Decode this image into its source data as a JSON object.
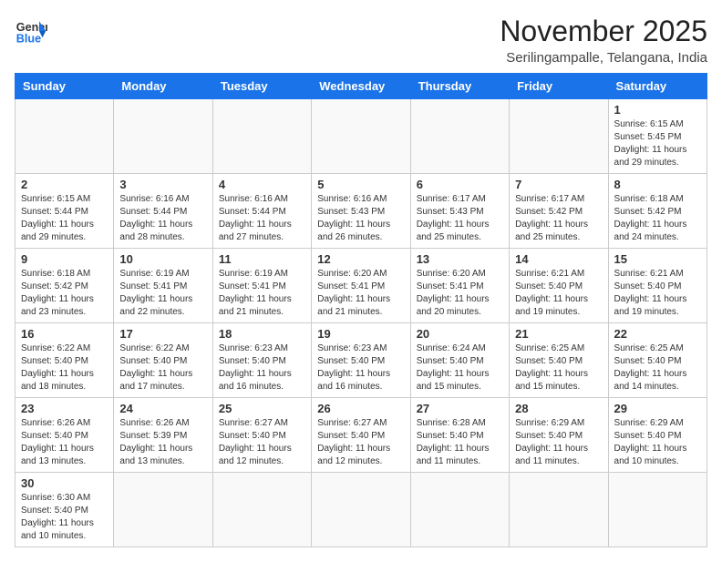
{
  "logo": {
    "text_general": "General",
    "text_blue": "Blue"
  },
  "header": {
    "month": "November 2025",
    "location": "Serilingampalle, Telangana, India"
  },
  "weekdays": [
    "Sunday",
    "Monday",
    "Tuesday",
    "Wednesday",
    "Thursday",
    "Friday",
    "Saturday"
  ],
  "weeks": [
    [
      {
        "day": "",
        "content": ""
      },
      {
        "day": "",
        "content": ""
      },
      {
        "day": "",
        "content": ""
      },
      {
        "day": "",
        "content": ""
      },
      {
        "day": "",
        "content": ""
      },
      {
        "day": "",
        "content": ""
      },
      {
        "day": "1",
        "content": "Sunrise: 6:15 AM\nSunset: 5:45 PM\nDaylight: 11 hours and 29 minutes."
      }
    ],
    [
      {
        "day": "2",
        "content": "Sunrise: 6:15 AM\nSunset: 5:44 PM\nDaylight: 11 hours and 29 minutes."
      },
      {
        "day": "3",
        "content": "Sunrise: 6:16 AM\nSunset: 5:44 PM\nDaylight: 11 hours and 28 minutes."
      },
      {
        "day": "4",
        "content": "Sunrise: 6:16 AM\nSunset: 5:44 PM\nDaylight: 11 hours and 27 minutes."
      },
      {
        "day": "5",
        "content": "Sunrise: 6:16 AM\nSunset: 5:43 PM\nDaylight: 11 hours and 26 minutes."
      },
      {
        "day": "6",
        "content": "Sunrise: 6:17 AM\nSunset: 5:43 PM\nDaylight: 11 hours and 25 minutes."
      },
      {
        "day": "7",
        "content": "Sunrise: 6:17 AM\nSunset: 5:42 PM\nDaylight: 11 hours and 25 minutes."
      },
      {
        "day": "8",
        "content": "Sunrise: 6:18 AM\nSunset: 5:42 PM\nDaylight: 11 hours and 24 minutes."
      }
    ],
    [
      {
        "day": "9",
        "content": "Sunrise: 6:18 AM\nSunset: 5:42 PM\nDaylight: 11 hours and 23 minutes."
      },
      {
        "day": "10",
        "content": "Sunrise: 6:19 AM\nSunset: 5:41 PM\nDaylight: 11 hours and 22 minutes."
      },
      {
        "day": "11",
        "content": "Sunrise: 6:19 AM\nSunset: 5:41 PM\nDaylight: 11 hours and 21 minutes."
      },
      {
        "day": "12",
        "content": "Sunrise: 6:20 AM\nSunset: 5:41 PM\nDaylight: 11 hours and 21 minutes."
      },
      {
        "day": "13",
        "content": "Sunrise: 6:20 AM\nSunset: 5:41 PM\nDaylight: 11 hours and 20 minutes."
      },
      {
        "day": "14",
        "content": "Sunrise: 6:21 AM\nSunset: 5:40 PM\nDaylight: 11 hours and 19 minutes."
      },
      {
        "day": "15",
        "content": "Sunrise: 6:21 AM\nSunset: 5:40 PM\nDaylight: 11 hours and 19 minutes."
      }
    ],
    [
      {
        "day": "16",
        "content": "Sunrise: 6:22 AM\nSunset: 5:40 PM\nDaylight: 11 hours and 18 minutes."
      },
      {
        "day": "17",
        "content": "Sunrise: 6:22 AM\nSunset: 5:40 PM\nDaylight: 11 hours and 17 minutes."
      },
      {
        "day": "18",
        "content": "Sunrise: 6:23 AM\nSunset: 5:40 PM\nDaylight: 11 hours and 16 minutes."
      },
      {
        "day": "19",
        "content": "Sunrise: 6:23 AM\nSunset: 5:40 PM\nDaylight: 11 hours and 16 minutes."
      },
      {
        "day": "20",
        "content": "Sunrise: 6:24 AM\nSunset: 5:40 PM\nDaylight: 11 hours and 15 minutes."
      },
      {
        "day": "21",
        "content": "Sunrise: 6:25 AM\nSunset: 5:40 PM\nDaylight: 11 hours and 15 minutes."
      },
      {
        "day": "22",
        "content": "Sunrise: 6:25 AM\nSunset: 5:40 PM\nDaylight: 11 hours and 14 minutes."
      }
    ],
    [
      {
        "day": "23",
        "content": "Sunrise: 6:26 AM\nSunset: 5:40 PM\nDaylight: 11 hours and 13 minutes."
      },
      {
        "day": "24",
        "content": "Sunrise: 6:26 AM\nSunset: 5:39 PM\nDaylight: 11 hours and 13 minutes."
      },
      {
        "day": "25",
        "content": "Sunrise: 6:27 AM\nSunset: 5:40 PM\nDaylight: 11 hours and 12 minutes."
      },
      {
        "day": "26",
        "content": "Sunrise: 6:27 AM\nSunset: 5:40 PM\nDaylight: 11 hours and 12 minutes."
      },
      {
        "day": "27",
        "content": "Sunrise: 6:28 AM\nSunset: 5:40 PM\nDaylight: 11 hours and 11 minutes."
      },
      {
        "day": "28",
        "content": "Sunrise: 6:29 AM\nSunset: 5:40 PM\nDaylight: 11 hours and 11 minutes."
      },
      {
        "day": "29",
        "content": "Sunrise: 6:29 AM\nSunset: 5:40 PM\nDaylight: 11 hours and 10 minutes."
      }
    ],
    [
      {
        "day": "30",
        "content": "Sunrise: 6:30 AM\nSunset: 5:40 PM\nDaylight: 11 hours and 10 minutes."
      },
      {
        "day": "",
        "content": ""
      },
      {
        "day": "",
        "content": ""
      },
      {
        "day": "",
        "content": ""
      },
      {
        "day": "",
        "content": ""
      },
      {
        "day": "",
        "content": ""
      },
      {
        "day": "",
        "content": ""
      }
    ]
  ]
}
